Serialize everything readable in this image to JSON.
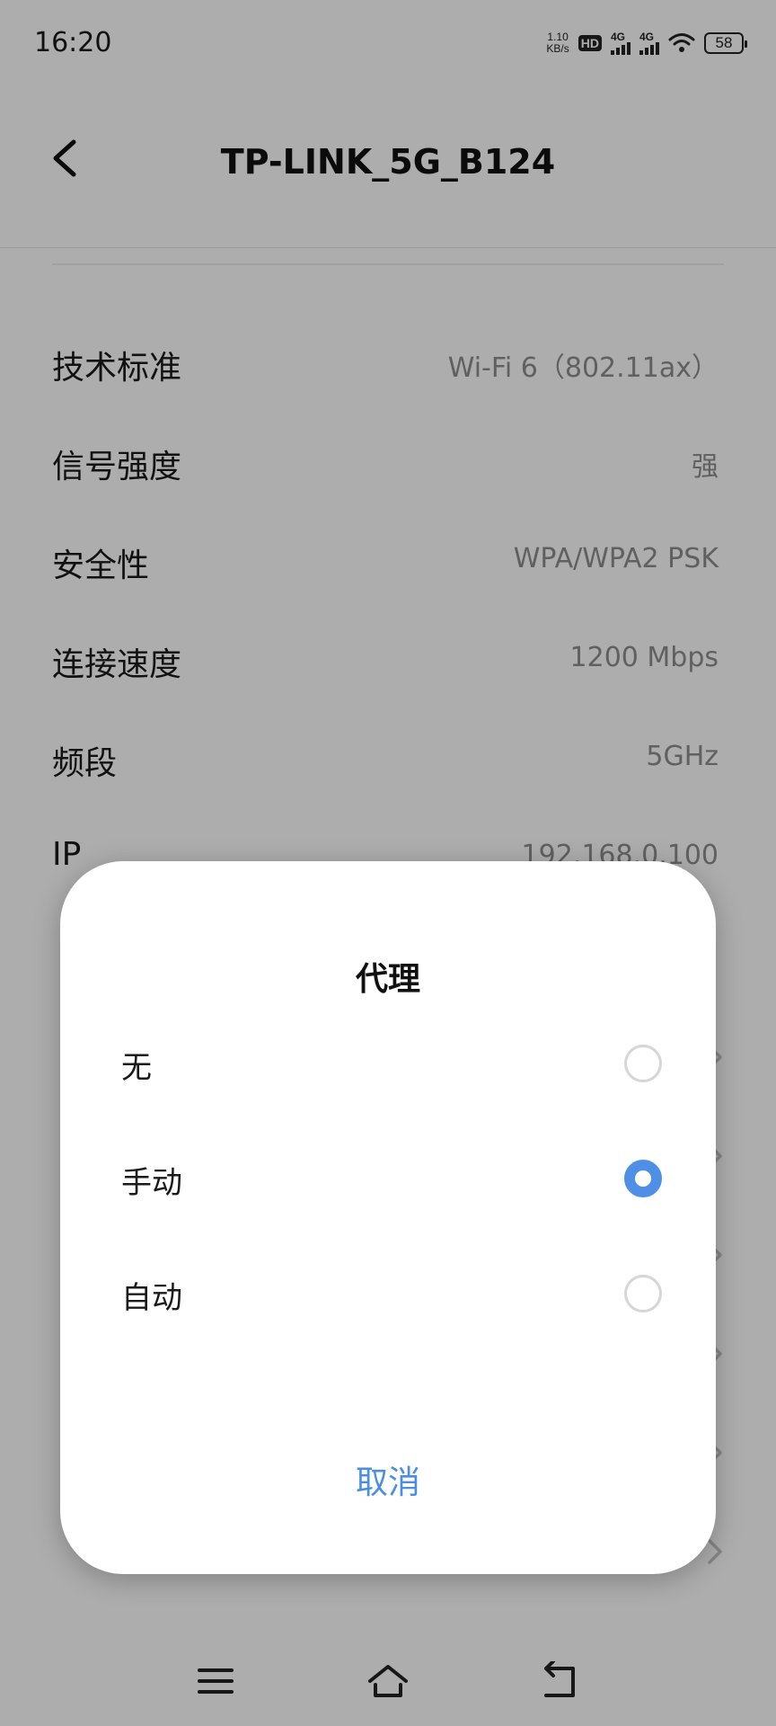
{
  "status_bar": {
    "time": "16:20",
    "net_speed_value": "1.10",
    "net_speed_unit": "KB/s",
    "hd_label": "HD",
    "sim1_label": "4G",
    "sim2_label": "4G",
    "battery": "58"
  },
  "header": {
    "title": "TP-LINK_5G_B124",
    "back_icon": "chevron-left-icon"
  },
  "info_rows": [
    {
      "label": "技术标准",
      "value": "Wi-Fi 6（802.11ax）"
    },
    {
      "label": "信号强度",
      "value": "强"
    },
    {
      "label": "安全性",
      "value": "WPA/WPA2 PSK"
    },
    {
      "label": "连接速度",
      "value": "1200 Mbps"
    },
    {
      "label": "频段",
      "value": "5GHz"
    },
    {
      "label": "IP",
      "value": "192.168.0.100"
    }
  ],
  "dialog": {
    "title": "代理",
    "options": [
      {
        "label": "无",
        "selected": false
      },
      {
        "label": "手动",
        "selected": true
      },
      {
        "label": "自动",
        "selected": false
      }
    ],
    "cancel_label": "取消",
    "accent_color": "#4f8fe6"
  },
  "nav_bar": {
    "icons": [
      "menu-icon",
      "home-icon",
      "back-icon"
    ]
  }
}
